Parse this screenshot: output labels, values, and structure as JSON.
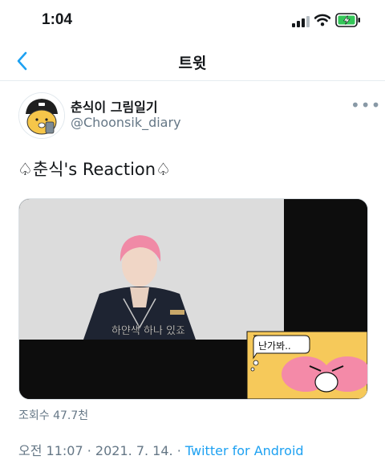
{
  "status_bar": {
    "time": "1:04"
  },
  "nav": {
    "title": "트윗",
    "back_icon": "chevron-left-icon"
  },
  "tweet": {
    "display_name": "춘식이 그림일기",
    "handle": "@Choonsik_diary",
    "text": "♤춘식's Reaction♤",
    "media": {
      "subtitle": "하얀색 하나 있죠",
      "sticker_text": "난가봐.."
    },
    "views": "조회수 47.7천",
    "time": "오전 11:07",
    "date": "2021. 7. 14.",
    "separator": "·",
    "client": "Twitter for Android"
  },
  "colors": {
    "accent": "#1da1f2",
    "secondary_text": "#657786",
    "battery": "#34c759",
    "divider": "#e6ecf0"
  }
}
